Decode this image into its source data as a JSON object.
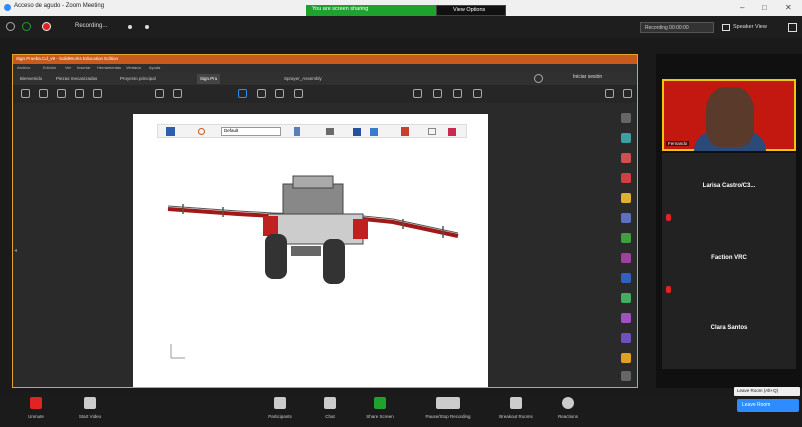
{
  "window": {
    "title": "Acceso de agudo - Zoom Meeting"
  },
  "banner": {
    "share_text": "You are screen sharing",
    "view_options": "View Options"
  },
  "top_toolbar": {
    "recording_text": "Recording...",
    "recording_label": "Recording 00:00:00",
    "speaker_view": "Speaker View"
  },
  "inner_app": {
    "title": "Sign.Prueba.Cd_v9 - SolidWorks Education Edition",
    "menu": [
      "Archivo",
      "Edición",
      "Ver",
      "Insertar",
      "Herramientas",
      "Ventana",
      "Ayuda"
    ],
    "tabs": [
      "Bienvenido",
      "Piezas mecanizadas",
      "Proyecto principal",
      "Sign.Pru",
      "Sprayer_Assembly"
    ],
    "active_tab_index": 3,
    "iniciar": "Iniciar sesión",
    "vp_select": "Default"
  },
  "participants": [
    {
      "name": "Fernando",
      "type": "video"
    },
    {
      "name": "Larisa Castro/C3...",
      "type": "name"
    },
    {
      "name": "Faction VRC",
      "type": "name"
    },
    {
      "name": "Clara Santos",
      "type": "name"
    }
  ],
  "controls": [
    {
      "label": "Unmute",
      "name": "unmute-button"
    },
    {
      "label": "Start Video",
      "name": "start-video-button"
    },
    {
      "label": "Participants",
      "name": "participants-button"
    },
    {
      "label": "Chat",
      "name": "chat-button"
    },
    {
      "label": "Share Screen",
      "name": "share-screen-button"
    },
    {
      "label": "Pause/Stop Recording",
      "name": "recording-button"
    },
    {
      "label": "Breakout Rooms",
      "name": "breakout-rooms-button"
    },
    {
      "label": "Reactions",
      "name": "reactions-button"
    }
  ],
  "leave": {
    "label": "Leave Room",
    "tooltip": "Leave Room (Alt+Q)"
  },
  "colors": {
    "zoom_blue": "#2d8cff",
    "share_green": "#1fa12e",
    "solidworks_orange": "#c85a1e"
  }
}
